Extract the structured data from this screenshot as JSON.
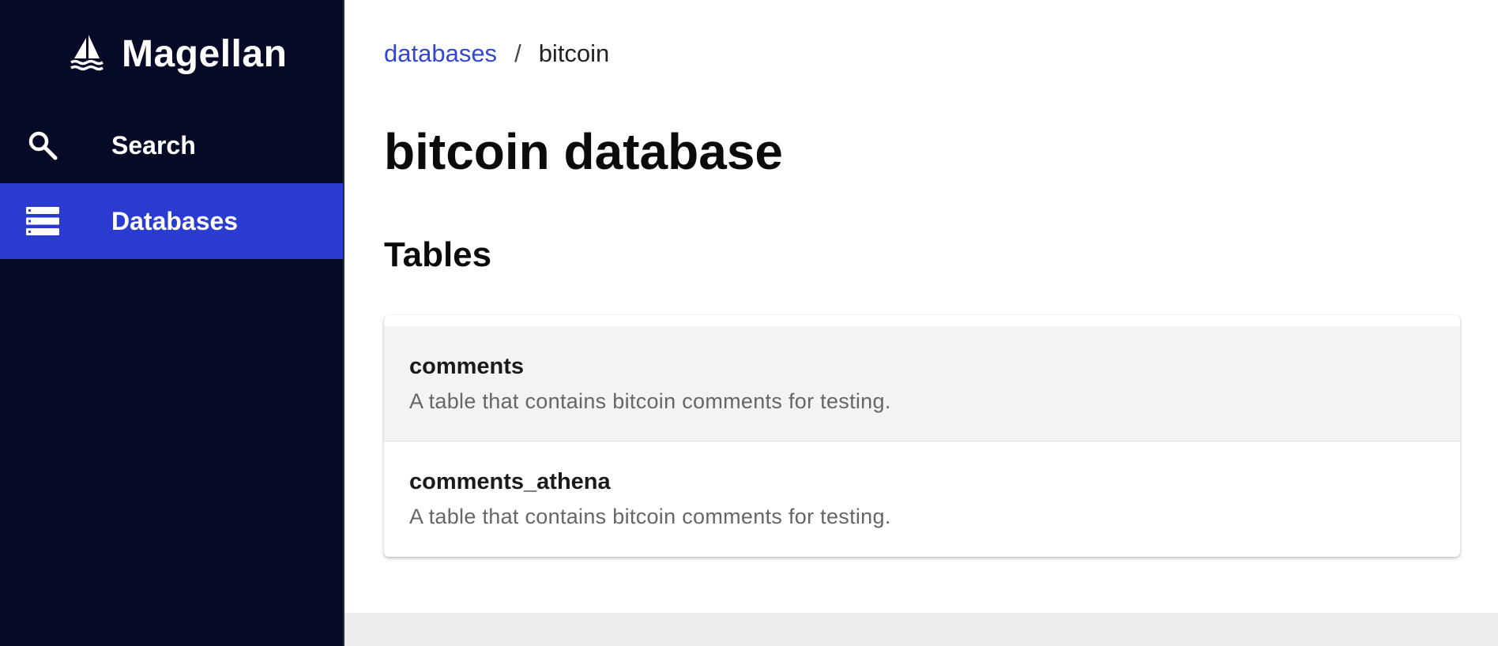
{
  "app": {
    "name": "Magellan",
    "logo_icon": "sailboat-icon"
  },
  "sidebar": {
    "items": [
      {
        "label": "Search",
        "icon": "search-icon",
        "active": false
      },
      {
        "label": "Databases",
        "icon": "database-list-icon",
        "active": true
      }
    ]
  },
  "breadcrumb": {
    "parent": "databases",
    "separator": "/",
    "current": "bitcoin"
  },
  "page": {
    "title": "bitcoin database",
    "section_title": "Tables"
  },
  "tables": [
    {
      "name": "comments",
      "description": "A table that contains bitcoin comments for testing."
    },
    {
      "name": "comments_athena",
      "description": "A table that contains bitcoin comments for testing."
    }
  ],
  "colors": {
    "sidebar_bg": "#070a26",
    "active_nav": "#2a3ccf",
    "link": "#3346d3"
  }
}
